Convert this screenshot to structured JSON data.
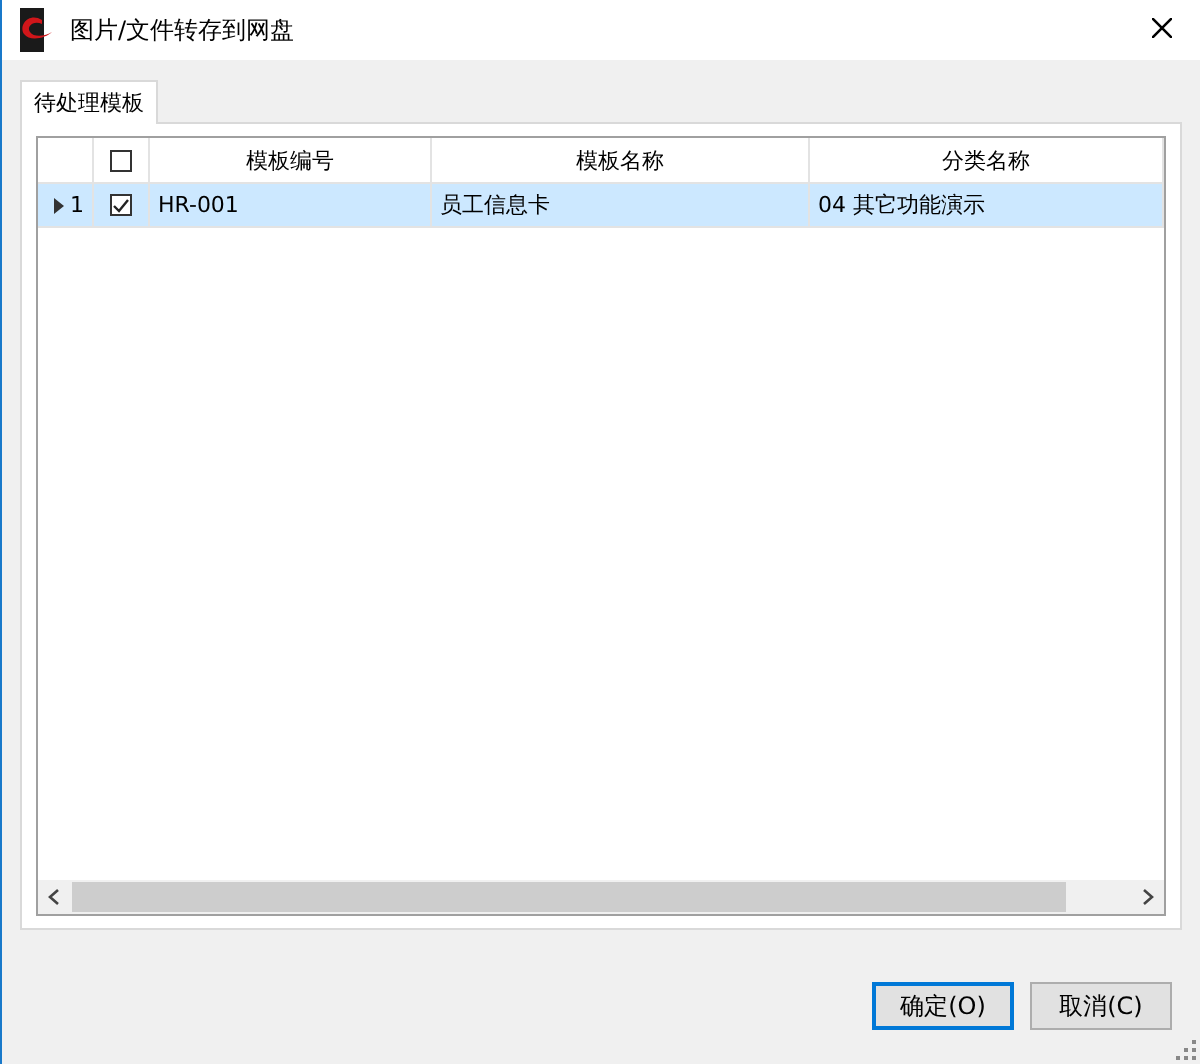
{
  "window": {
    "title": "图片/文件转存到网盘"
  },
  "tabs": [
    {
      "label": "待处理模板",
      "selected": true
    }
  ],
  "table": {
    "header_checked": false,
    "columns": [
      "模板编号",
      "模板名称",
      "分类名称"
    ],
    "rows": [
      {
        "row_number": "1",
        "current": true,
        "selected": true,
        "checked": true,
        "cells": [
          "HR-001",
          "员工信息卡",
          "04 其它功能演示"
        ]
      }
    ]
  },
  "buttons": [
    {
      "label": "确定(O)",
      "default": true
    },
    {
      "label": "取消(C)",
      "default": false
    }
  ]
}
